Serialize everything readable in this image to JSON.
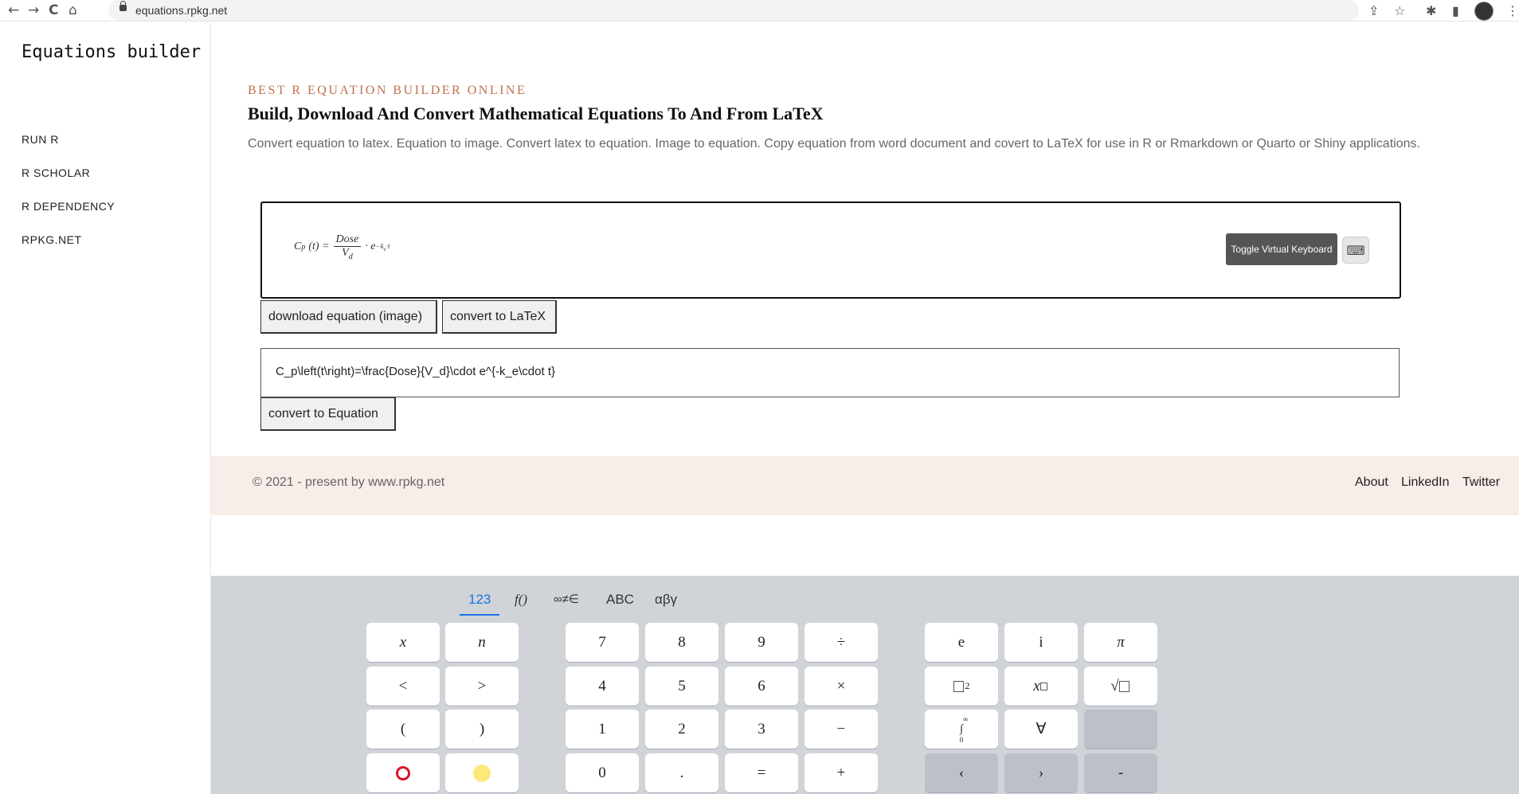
{
  "browser": {
    "url": "equations.rpkg.net",
    "back_icon": "←",
    "forward_icon": "→",
    "reload_icon": "C",
    "home_icon": "⌂",
    "share_icon": "⇪",
    "star_icon": "☆",
    "extensions_icon": "✱",
    "sidepanel_icon": "▮",
    "menu_icon": "⋮"
  },
  "sidebar": {
    "brand": "Equations builder",
    "links": [
      "RUN R",
      "R SCHOLAR",
      "R DEPENDENCY",
      "RPKG.NET"
    ]
  },
  "main": {
    "eyebrow": "BEST R EQUATION BUILDER ONLINE",
    "title": "Build, Download And Convert Mathematical Equations To And From LaTeX",
    "description": "Convert equation to latex. Equation to image. Convert latex to equation. Image to equation. Copy equation from word document and covert to LaTeX for use in R or Rmarkdown or Quarto or Shiny applications.",
    "formula": {
      "lhs": "C",
      "lhs_sub": "p",
      "lhs_arg": "(t) =",
      "numerator": "Dose",
      "denominator": "V",
      "denominator_sub": "d",
      "operator": "· e",
      "exponent": "−k",
      "exponent_sub": "e",
      "exponent_tail": "·t"
    },
    "toggle_keyboard_label": "Toggle Virtual Keyboard",
    "keyboard_icon": "⌨",
    "download_button": "download equation (image)",
    "convert_latex_button": "convert to LaTeX",
    "latex_value": "C_p\\left(t\\right)=\\frac{Dose}{V_d}\\cdot e^{-k_e\\cdot t}",
    "convert_equation_button": "convert to Equation"
  },
  "footer": {
    "copyright": "© 2021 - present by www.rpkg.net",
    "links": [
      "About",
      "LinkedIn",
      "Twitter"
    ]
  },
  "virtual_keyboard": {
    "tabs": [
      "123",
      "f()",
      "∞≠∈",
      "ABC",
      "αβγ"
    ],
    "active_tab": "123",
    "left_keys": [
      "x",
      "n",
      "<",
      ">",
      "(",
      ")"
    ],
    "num_keys": [
      "7",
      "8",
      "9",
      "÷",
      "4",
      "5",
      "6",
      "×",
      "1",
      "2",
      "3",
      "−",
      "0",
      ".",
      "=",
      "+"
    ],
    "right_keys": [
      "e",
      "i",
      "π",
      "2",
      "x",
      "√",
      "∫",
      "∀",
      "",
      "‹",
      "›",
      "-"
    ],
    "integral_upper": "∞",
    "integral_lower": "0"
  }
}
